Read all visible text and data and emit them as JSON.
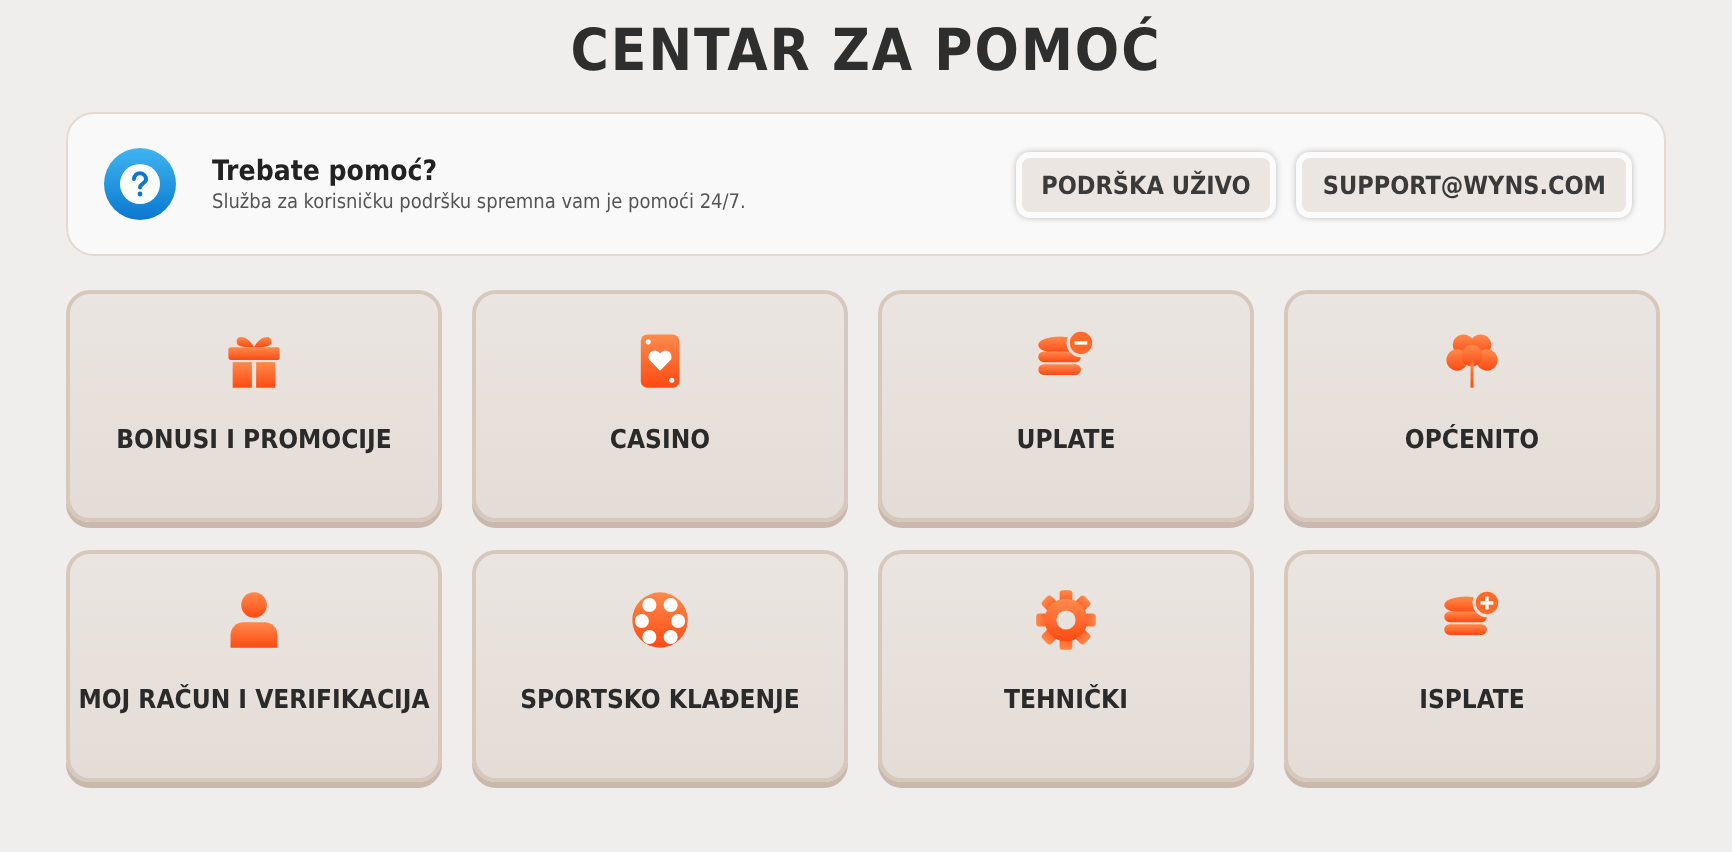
{
  "title": "CENTAR ZA POMOĆ",
  "help_banner": {
    "heading": "Trebate pomoć?",
    "text": "Služba za korisničku podršku spremna vam je pomoći 24/7.",
    "buttons": [
      "PODRŠKA UŽIVO",
      "SUPPORT@WYNS.COM"
    ]
  },
  "categories": [
    {
      "label": "BONUSI I PROMOCIJE",
      "kind": "gift"
    },
    {
      "label": "CASINO",
      "kind": "card"
    },
    {
      "label": "UPLATE",
      "kind": "coins-minus"
    },
    {
      "label": "OPĆENITO",
      "kind": "clover"
    },
    {
      "label": "MOJ RAČUN I VERIFIKACIJA",
      "kind": "person"
    },
    {
      "label": "SPORTSKO KLAĐENJE",
      "kind": "ball"
    },
    {
      "label": "TEHNIČKI",
      "kind": "gear"
    },
    {
      "label": "ISPLATE",
      "kind": "coins-plus"
    }
  ]
}
